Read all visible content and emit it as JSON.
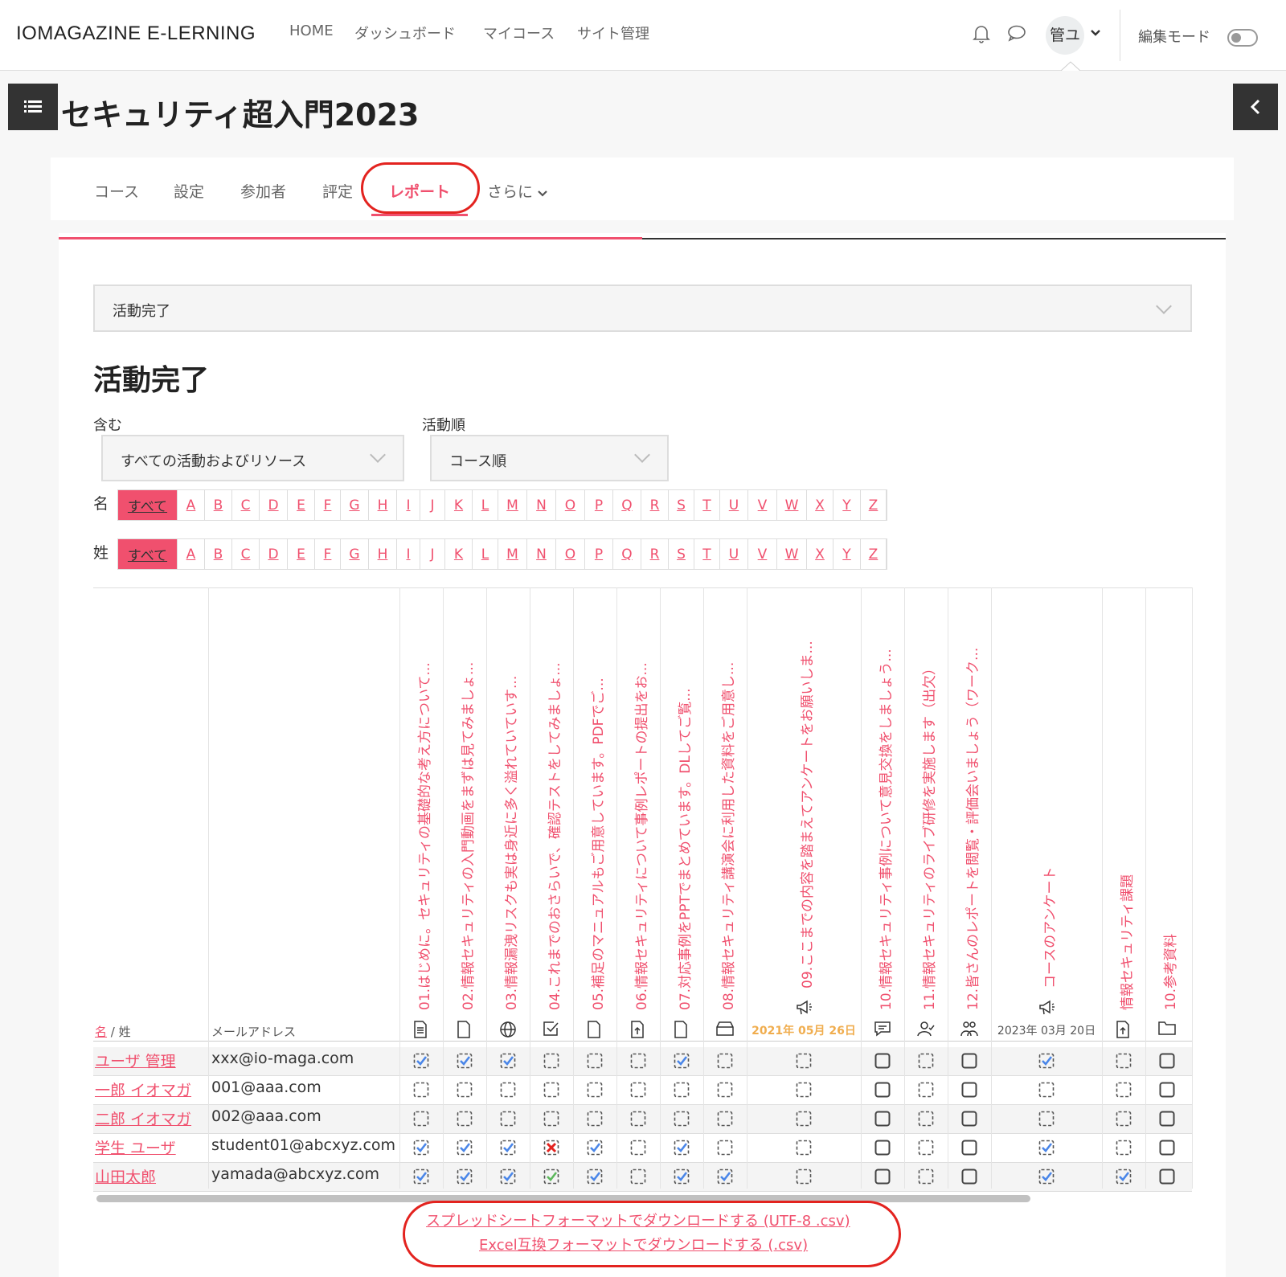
{
  "navbar": {
    "brand": "IOMAGAZINE E-LERNING",
    "links": [
      "HOME",
      "ダッシュボード",
      "マイコース",
      "サイト管理"
    ],
    "avatar": "管ユ",
    "edit_mode_label": "編集モード",
    "icons": [
      "bell-icon",
      "chat-icon",
      "chevron-down-icon"
    ]
  },
  "page": {
    "title": "セキュリティ超入門2023"
  },
  "secondary_nav": {
    "tabs": [
      "コース",
      "設定",
      "参加者",
      "評定",
      "レポート",
      "さらに"
    ]
  },
  "report_select": "活動完了",
  "heading": "活動完了",
  "filters": {
    "include_label": "含む",
    "include_value": "すべての活動およびリソース",
    "order_label": "活動順",
    "order_value": "コース順"
  },
  "initials": {
    "first_label": "名",
    "last_label": "姓",
    "all": "すべて",
    "letters": [
      "A",
      "B",
      "C",
      "D",
      "E",
      "F",
      "G",
      "H",
      "I",
      "J",
      "K",
      "L",
      "M",
      "N",
      "O",
      "P",
      "Q",
      "R",
      "S",
      "T",
      "U",
      "V",
      "W",
      "X",
      "Y",
      "Z"
    ]
  },
  "table": {
    "sort_first": "名",
    "sort_sep": " / 姓",
    "email_header": "メールアドレス",
    "columns": [
      {
        "label": "01.はじめに。セキュリティの基礎的な考え方について...",
        "icon": "page-icon",
        "date": ""
      },
      {
        "label": "02.情報セキュリティの入門動画をまずは見てみましょ...",
        "icon": "file-icon",
        "date": ""
      },
      {
        "label": "03.情報漏洩リスクも実は身近に多く溢れていていす...",
        "icon": "url-globe-icon",
        "date": ""
      },
      {
        "label": "04.これまでのおさらいで、確認テストをしてみましょ...",
        "icon": "quiz-check-icon",
        "date": ""
      },
      {
        "label": "05.補足のマニュアルもご用意しています。PDFでご...",
        "icon": "file-icon",
        "date": ""
      },
      {
        "label": "06.情報セキュリティについて事例レポートの提出をお...",
        "icon": "assignment-upload-icon",
        "date": ""
      },
      {
        "label": "07.対応事例をPPTでまとめています。DLしてご覧...",
        "icon": "file-icon",
        "date": ""
      },
      {
        "label": "08.情報セキュリティ講演会に利用した資料をご用意し...",
        "icon": "folder-box-icon",
        "date": ""
      },
      {
        "label": "09.ここまでの内容を踏まえてアンケートをお願いしま...",
        "icon": "feedback-megaphone-icon",
        "date": "2021年 05月 26日"
      },
      {
        "label": "10.情報セキュリティ事例について意見交換をしましょう...",
        "icon": "forum-icon",
        "date": ""
      },
      {
        "label": "11.情報セキュリティのライブ研修を実施します（出欠）",
        "icon": "attendance-icon",
        "date": ""
      },
      {
        "label": "12.皆さんのレポートを閲覧・評価会いましょう（ワーク...",
        "icon": "workshop-icon",
        "date": ""
      },
      {
        "label": "コースのアンケート",
        "icon": "feedback-megaphone-icon",
        "date": "2023年 03月 20日"
      },
      {
        "label": "情報セキュリティ課題",
        "icon": "assignment-upload-icon",
        "date": ""
      },
      {
        "label": "10.参考資料",
        "icon": "folder-icon",
        "date": ""
      }
    ],
    "rows": [
      {
        "name": "ユーザ 管理",
        "email": "xxx@io-maga.com",
        "status": [
          "c",
          "c",
          "c",
          "e",
          "e",
          "e",
          "c",
          "e",
          "e",
          "m",
          "e",
          "m",
          "c",
          "e",
          "m"
        ]
      },
      {
        "name": "一郎 イオマガ",
        "email": "001@aaa.com",
        "status": [
          "e",
          "e",
          "e",
          "e",
          "e",
          "e",
          "e",
          "e",
          "e",
          "m",
          "e",
          "m",
          "e",
          "e",
          "m"
        ]
      },
      {
        "name": "二郎 イオマガ",
        "email": "002@aaa.com",
        "status": [
          "e",
          "e",
          "e",
          "e",
          "e",
          "e",
          "e",
          "e",
          "e",
          "m",
          "e",
          "m",
          "e",
          "e",
          "m"
        ]
      },
      {
        "name": "学生 ユーザ",
        "email": "student01@abcxyz.com",
        "status": [
          "c",
          "c",
          "c",
          "x",
          "c",
          "e",
          "c",
          "e",
          "e",
          "m",
          "e",
          "m",
          "c",
          "e",
          "m"
        ]
      },
      {
        "name": "山田太郎",
        "email": "yamada@abcxyz.com",
        "status": [
          "c",
          "c",
          "c",
          "g",
          "c",
          "e",
          "c",
          "c",
          "e",
          "m",
          "e",
          "m",
          "c",
          "c",
          "m"
        ]
      }
    ]
  },
  "downloads": {
    "utf8": "スプレッドシートフォーマットでダウンロードする (UTF-8 .csv)",
    "excel": "Excel互換フォーマットでダウンロードする (.csv)"
  },
  "colors": {
    "accent": "#f0506e",
    "annotation": "#e3231f",
    "check_blue": "#4a86e8",
    "date_orange": "#f0ad4e"
  }
}
